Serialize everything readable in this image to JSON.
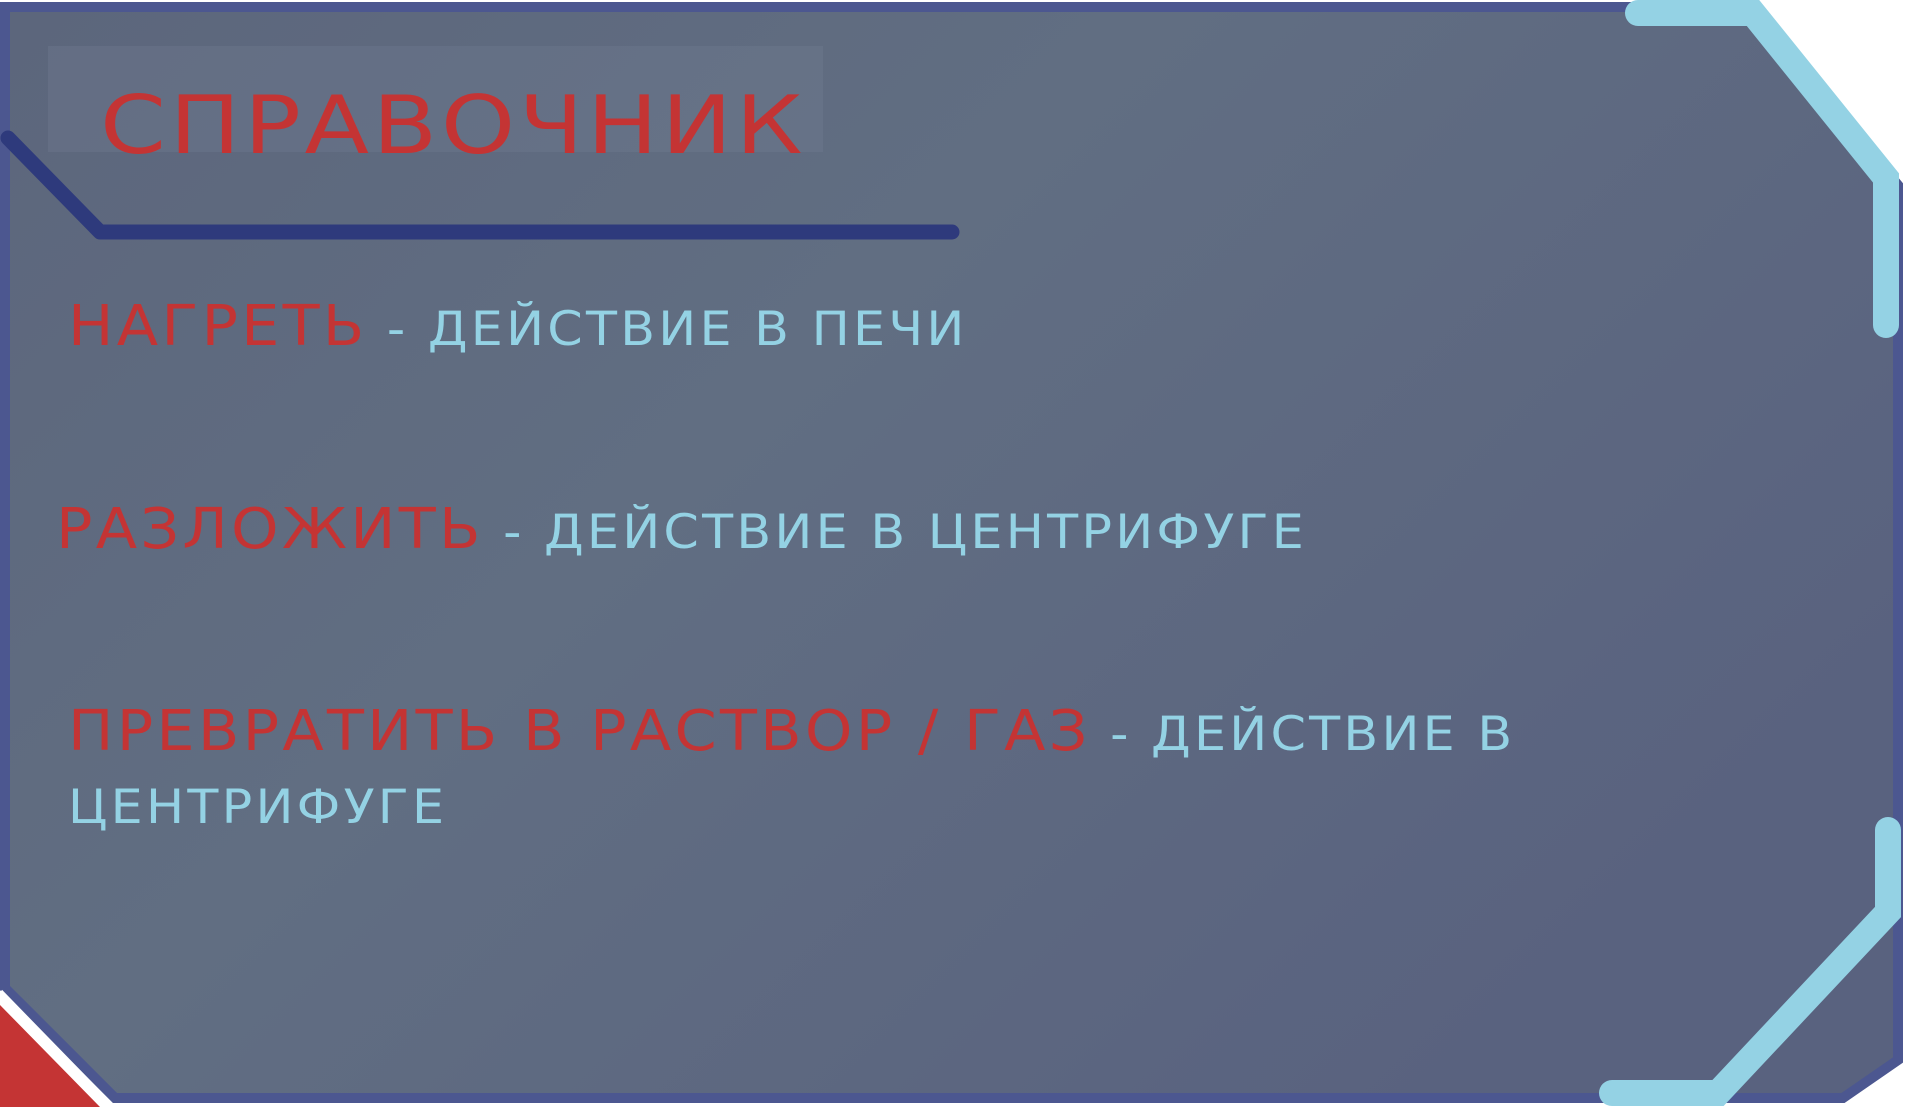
{
  "panel": {
    "title": "СПРАВОЧНИК",
    "entries": [
      {
        "term": "НАГРЕТЬ",
        "separator": " - ",
        "description": "ДЕЙСТВИЕ В ПЕЧИ"
      },
      {
        "term": "РАЗЛОЖИТЬ",
        "separator": " - ",
        "description": "ДЕЙСТВИЕ В ЦЕНТРИФУГЕ"
      },
      {
        "term": "ПРЕВРАТИТЬ В РАСТВОР / ГАЗ",
        "separator": " - ",
        "description": "ДЕЙСТВИЕ В ЦЕНТРИФУГЕ"
      }
    ]
  },
  "colors": {
    "panel_background": "#5f6c82",
    "panel_border": "#4c5790",
    "accent_dark": "#2e3a7c",
    "accent_light": "#94d2e4",
    "accent_red": "#c43434",
    "term_text": "#c43434",
    "description_text": "#94d2e4"
  }
}
